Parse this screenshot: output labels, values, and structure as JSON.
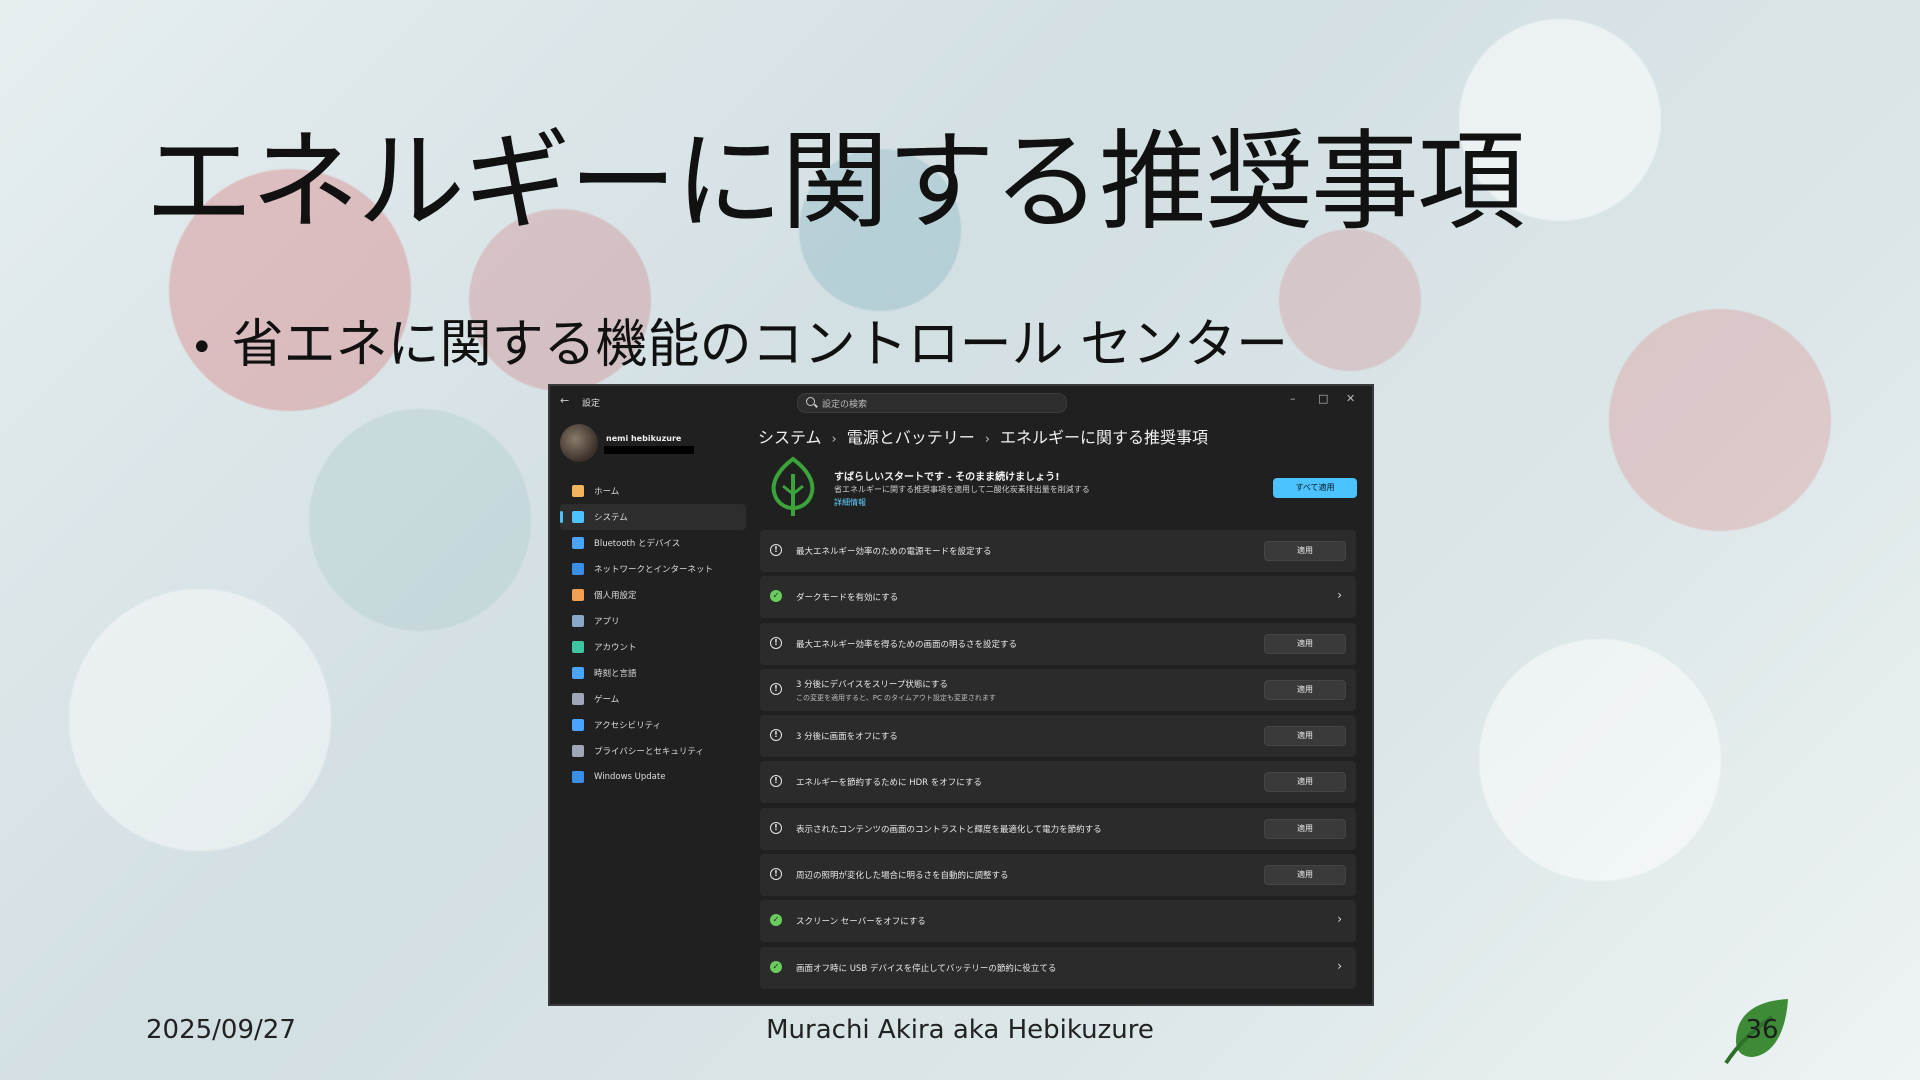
{
  "slide": {
    "title": "エネルギーに関する推奨事項",
    "bullet": "省エネに関する機能のコントロール センター",
    "footer_date": "2025/09/27",
    "footer_author": "Murachi Akira aka Hebikuzure",
    "page_number": "36"
  },
  "window": {
    "app_title": "設定",
    "search_placeholder": "設定の検索",
    "controls": {
      "minimize": "–",
      "maximize": "□",
      "close": "✕"
    },
    "profile_name": "nemi hebikuzure",
    "nav": [
      {
        "label": "ホーム",
        "icon": "home-icon",
        "color": "#f2b45c"
      },
      {
        "label": "システム",
        "icon": "system-icon",
        "color": "#4cc2ff",
        "active": true
      },
      {
        "label": "Bluetooth とデバイス",
        "icon": "bluetooth-icon",
        "color": "#4aa3ff"
      },
      {
        "label": "ネットワークとインターネット",
        "icon": "network-icon",
        "color": "#3a8ee6"
      },
      {
        "label": "個人用設定",
        "icon": "brush-icon",
        "color": "#f0a050"
      },
      {
        "label": "アプリ",
        "icon": "apps-icon",
        "color": "#8aa8c8"
      },
      {
        "label": "アカウント",
        "icon": "account-icon",
        "color": "#3fc6a0"
      },
      {
        "label": "時刻と言語",
        "icon": "globe-icon",
        "color": "#4aa3ff"
      },
      {
        "label": "ゲーム",
        "icon": "gamepad-icon",
        "color": "#a0a8b8"
      },
      {
        "label": "アクセシビリティ",
        "icon": "accessibility-icon",
        "color": "#4aa3ff"
      },
      {
        "label": "プライバシーとセキュリティ",
        "icon": "shield-icon",
        "color": "#a0a8b8"
      },
      {
        "label": "Windows Update",
        "icon": "update-icon",
        "color": "#3a8ee6"
      }
    ],
    "breadcrumb": [
      "システム",
      "電源とバッテリー",
      "エネルギーに関する推奨事項"
    ],
    "hero": {
      "title": "すばらしいスタートです - そのまま続けましょう!",
      "subtitle": "省エネルギーに関する推奨事項を適用して二酸化炭素排出量を削減する",
      "link": "詳細情報",
      "apply_all": "すべて適用"
    },
    "recommendations": [
      {
        "status": "info",
        "label": "最大エネルギー効率のための電源モードを設定する",
        "action": "適用"
      },
      {
        "status": "done",
        "label": "ダークモードを有効にする",
        "action": "chevron"
      },
      {
        "status": "info",
        "label": "最大エネルギー効率を得るための画面の明るさを設定する",
        "action": "適用"
      },
      {
        "status": "info",
        "label": "3 分後にデバイスをスリープ状態にする",
        "sublabel": "この変更を適用すると、PC のタイムアウト設定も変更されます",
        "action": "適用"
      },
      {
        "status": "info",
        "label": "3 分後に画面をオフにする",
        "action": "適用"
      },
      {
        "status": "info",
        "label": "エネルギーを節約するために HDR をオフにする",
        "action": "適用"
      },
      {
        "status": "info",
        "label": "表示されたコンテンツの画面のコントラストと輝度を最適化して電力を節約する",
        "action": "適用"
      },
      {
        "status": "info",
        "label": "周辺の照明が変化した場合に明るさを自動的に調整する",
        "action": "適用"
      },
      {
        "status": "done",
        "label": "スクリーン セーバーをオフにする",
        "action": "chevron"
      },
      {
        "status": "done",
        "label": "画面オフ時に USB デバイスを停止してバッテリーの節約に役立てる",
        "action": "chevron"
      }
    ]
  },
  "colors": {
    "accent": "#4cc2ff",
    "check": "#6ccb5f",
    "leaf": "#3aa33a"
  }
}
